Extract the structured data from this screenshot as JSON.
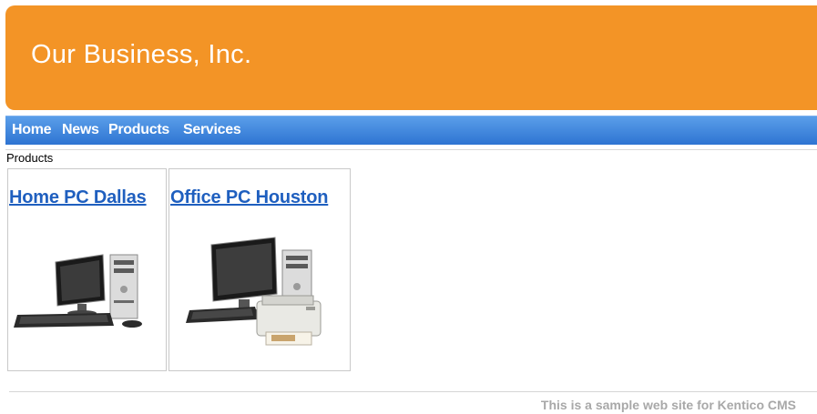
{
  "header": {
    "site_title": "Our Business, Inc."
  },
  "nav": {
    "items": [
      "Home",
      "News",
      "Products",
      "Services"
    ]
  },
  "breadcrumb": "Products",
  "products": [
    {
      "name": "Home PC Dallas"
    },
    {
      "name": "Office PC Houston"
    }
  ],
  "footer": {
    "text": "This is a sample web site for Kentico CMS"
  },
  "colors": {
    "header": "#f39426",
    "nav": "#2e74d2",
    "link": "#1f5fbf",
    "footer_text": "#a8a8a8"
  }
}
